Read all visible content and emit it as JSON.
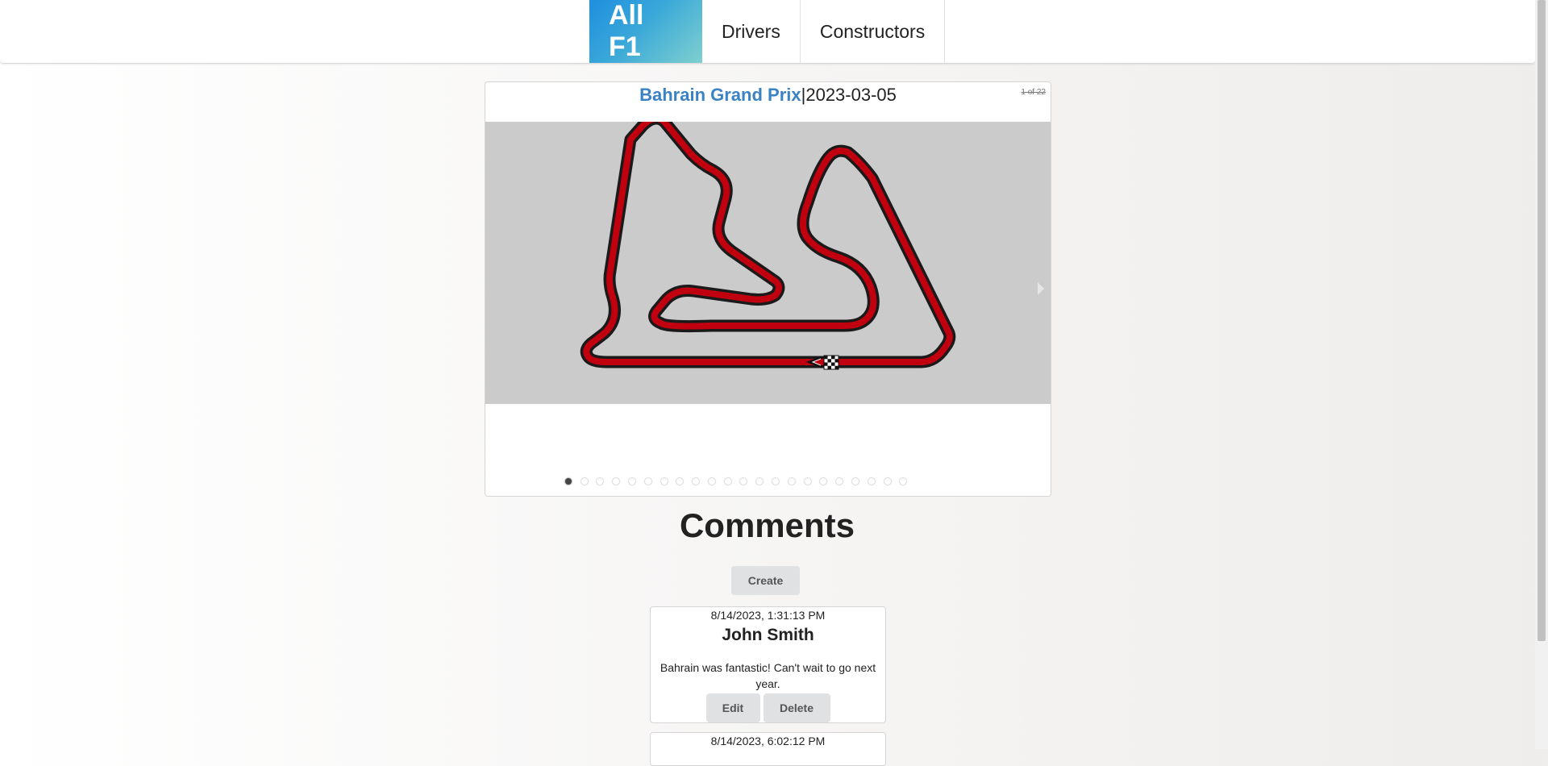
{
  "nav": {
    "brand": "All F1",
    "items": [
      "Drivers",
      "Constructors"
    ]
  },
  "race": {
    "name": "Bahrain Grand Prix",
    "separator": "|",
    "date": "2023-03-05",
    "counter": "1 of 22",
    "track_color": "#c0000f",
    "slide_index": 1,
    "slide_total": 22
  },
  "comments": {
    "heading": "Comments",
    "create_label": "Create",
    "items": [
      {
        "date": "8/14/2023, 1:31:13 PM",
        "author": "John Smith",
        "text": "Bahrain was fantastic! Can't wait to go next year.",
        "edit_label": "Edit",
        "delete_label": "Delete"
      },
      {
        "date": "8/14/2023, 6:02:12 PM"
      }
    ]
  },
  "colors": {
    "brand_gradient_start": "#1f8fe0",
    "brand_gradient_end": "#7fd0cf",
    "race_name": "#3b82c4"
  }
}
